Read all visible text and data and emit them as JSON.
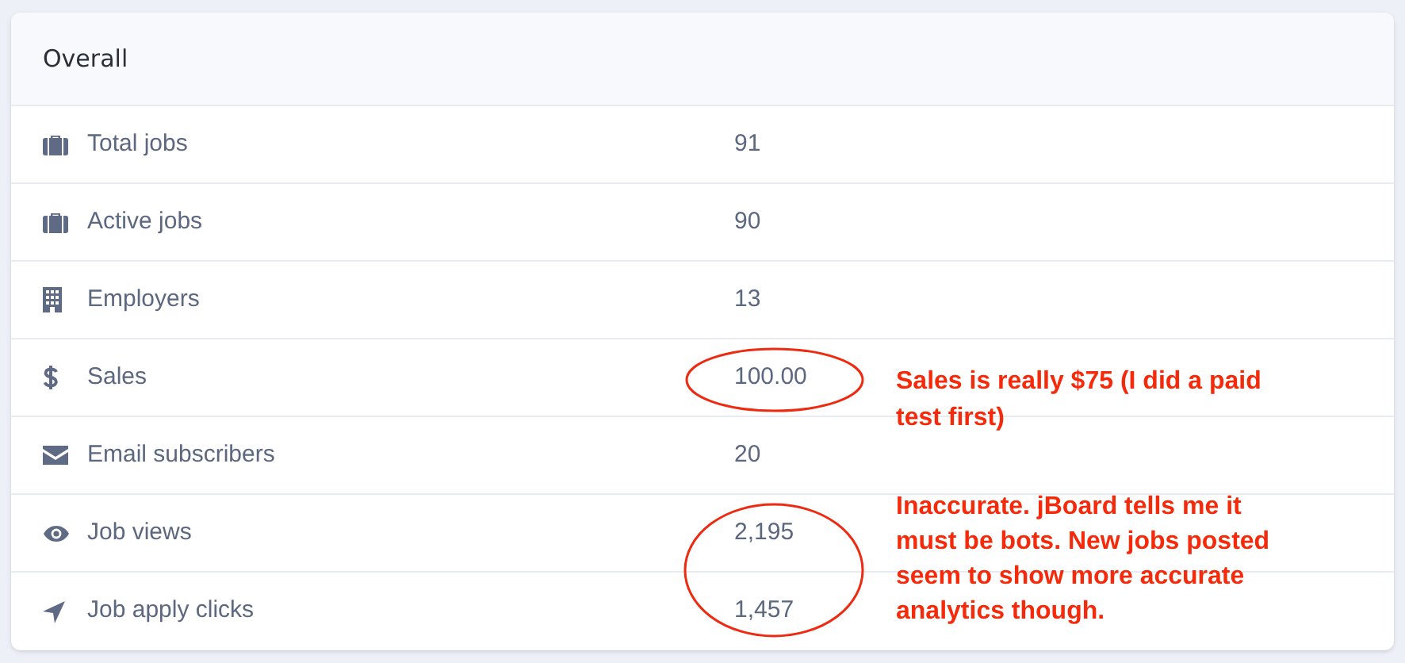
{
  "card": {
    "title": "Overall"
  },
  "rows": [
    {
      "kind": "briefcase",
      "label": "Total jobs",
      "value": "91"
    },
    {
      "kind": "briefcase",
      "label": "Active jobs",
      "value": "90"
    },
    {
      "kind": "building",
      "label": "Employers",
      "value": "13"
    },
    {
      "kind": "dollar",
      "label": "Sales",
      "value": "100.00"
    },
    {
      "kind": "envelope",
      "label": "Email subscribers",
      "value": "20"
    },
    {
      "kind": "eye",
      "label": "Job views",
      "value": "2,195"
    },
    {
      "kind": "send",
      "label": "Job apply clicks",
      "value": "1,457"
    }
  ],
  "annotations": [
    {
      "text": "Sales is really $75 (I did a paid test first)"
    },
    {
      "text": "Inaccurate. jBoard tells me it must be bots. New jobs posted seem to show more accurate analytics though."
    }
  ]
}
